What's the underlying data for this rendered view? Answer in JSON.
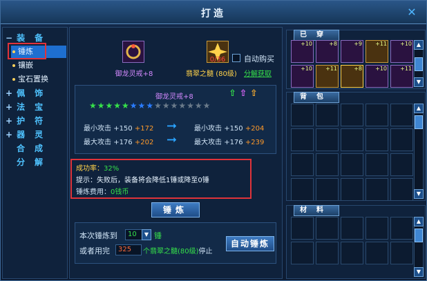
{
  "window": {
    "title": "打造"
  },
  "nav": {
    "groups": [
      {
        "sign": "−",
        "label": "装备"
      },
      {
        "sign": "+",
        "label": "佩饰"
      },
      {
        "sign": "+",
        "label": "法宝"
      },
      {
        "sign": "+",
        "label": "护符"
      },
      {
        "sign": "+",
        "label": "器灵"
      },
      {
        "sign": "",
        "label": "合成"
      },
      {
        "sign": "",
        "label": "分解"
      }
    ],
    "sub_items": [
      "锤炼",
      "镶嵌",
      "宝石置换"
    ]
  },
  "forge": {
    "item_name": "御龙灵戒+8",
    "material_count": "0/36",
    "auto_buy_label": "自动购买",
    "material_name": "翡翠之髓",
    "material_level": "(80级)",
    "decompose_link": "分解获取",
    "info_title": "御龙灵戒+8",
    "star_row_1": "★★★★★",
    "star_row_2": "★★★",
    "star_row_3": "★★★★★★★",
    "stats": {
      "min_attack_label": "最小攻击",
      "max_attack_label": "最大攻击",
      "min_base": "+150",
      "min_cur": "+172",
      "min_next": "+204",
      "max_base": "+176",
      "max_cur": "+202",
      "max_next": "+239"
    },
    "notice": {
      "success_label": "成功率：",
      "success_value": "32%",
      "tip": "提示：失败后，装备将会降低1锤或降至0锤",
      "cost_label": "锤炼费用：",
      "cost_value": "0钱币"
    },
    "forge_button": "锤炼",
    "auto": {
      "times_label": "本次锤炼到",
      "times_value": "10",
      "times_unit": "锤",
      "or_label": "或者用完",
      "use_value": "325",
      "use_unit": "个翡翠之髓",
      "use_level": "(80级)",
      "stop_label": "停止",
      "button": "自动锤炼"
    }
  },
  "right": {
    "equipped_tab": "已穿",
    "bag_tab": "背包",
    "material_tab": "材料",
    "equipped_levels": [
      "+10",
      "+8",
      "+9",
      "+11",
      "+10",
      "+10",
      "+11",
      "+8",
      "+10",
      "+11"
    ]
  },
  "colors": {
    "accent": "#4fc3ff",
    "highlight_red": "#e0333a",
    "success_green": "#36e04a",
    "stat_orange": "#ff9a2a"
  }
}
